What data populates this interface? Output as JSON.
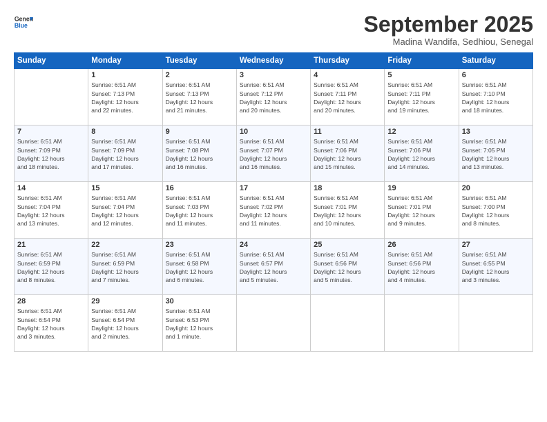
{
  "header": {
    "logo_line1": "General",
    "logo_line2": "Blue",
    "month_title": "September 2025",
    "subtitle": "Madina Wandifa, Sedhiou, Senegal"
  },
  "weekdays": [
    "Sunday",
    "Monday",
    "Tuesday",
    "Wednesday",
    "Thursday",
    "Friday",
    "Saturday"
  ],
  "weeks": [
    [
      {
        "day": "",
        "info": ""
      },
      {
        "day": "1",
        "info": "Sunrise: 6:51 AM\nSunset: 7:13 PM\nDaylight: 12 hours\nand 22 minutes."
      },
      {
        "day": "2",
        "info": "Sunrise: 6:51 AM\nSunset: 7:13 PM\nDaylight: 12 hours\nand 21 minutes."
      },
      {
        "day": "3",
        "info": "Sunrise: 6:51 AM\nSunset: 7:12 PM\nDaylight: 12 hours\nand 20 minutes."
      },
      {
        "day": "4",
        "info": "Sunrise: 6:51 AM\nSunset: 7:11 PM\nDaylight: 12 hours\nand 20 minutes."
      },
      {
        "day": "5",
        "info": "Sunrise: 6:51 AM\nSunset: 7:11 PM\nDaylight: 12 hours\nand 19 minutes."
      },
      {
        "day": "6",
        "info": "Sunrise: 6:51 AM\nSunset: 7:10 PM\nDaylight: 12 hours\nand 18 minutes."
      }
    ],
    [
      {
        "day": "7",
        "info": "Sunrise: 6:51 AM\nSunset: 7:09 PM\nDaylight: 12 hours\nand 18 minutes."
      },
      {
        "day": "8",
        "info": "Sunrise: 6:51 AM\nSunset: 7:09 PM\nDaylight: 12 hours\nand 17 minutes."
      },
      {
        "day": "9",
        "info": "Sunrise: 6:51 AM\nSunset: 7:08 PM\nDaylight: 12 hours\nand 16 minutes."
      },
      {
        "day": "10",
        "info": "Sunrise: 6:51 AM\nSunset: 7:07 PM\nDaylight: 12 hours\nand 16 minutes."
      },
      {
        "day": "11",
        "info": "Sunrise: 6:51 AM\nSunset: 7:06 PM\nDaylight: 12 hours\nand 15 minutes."
      },
      {
        "day": "12",
        "info": "Sunrise: 6:51 AM\nSunset: 7:06 PM\nDaylight: 12 hours\nand 14 minutes."
      },
      {
        "day": "13",
        "info": "Sunrise: 6:51 AM\nSunset: 7:05 PM\nDaylight: 12 hours\nand 13 minutes."
      }
    ],
    [
      {
        "day": "14",
        "info": "Sunrise: 6:51 AM\nSunset: 7:04 PM\nDaylight: 12 hours\nand 13 minutes."
      },
      {
        "day": "15",
        "info": "Sunrise: 6:51 AM\nSunset: 7:04 PM\nDaylight: 12 hours\nand 12 minutes."
      },
      {
        "day": "16",
        "info": "Sunrise: 6:51 AM\nSunset: 7:03 PM\nDaylight: 12 hours\nand 11 minutes."
      },
      {
        "day": "17",
        "info": "Sunrise: 6:51 AM\nSunset: 7:02 PM\nDaylight: 12 hours\nand 11 minutes."
      },
      {
        "day": "18",
        "info": "Sunrise: 6:51 AM\nSunset: 7:01 PM\nDaylight: 12 hours\nand 10 minutes."
      },
      {
        "day": "19",
        "info": "Sunrise: 6:51 AM\nSunset: 7:01 PM\nDaylight: 12 hours\nand 9 minutes."
      },
      {
        "day": "20",
        "info": "Sunrise: 6:51 AM\nSunset: 7:00 PM\nDaylight: 12 hours\nand 8 minutes."
      }
    ],
    [
      {
        "day": "21",
        "info": "Sunrise: 6:51 AM\nSunset: 6:59 PM\nDaylight: 12 hours\nand 8 minutes."
      },
      {
        "day": "22",
        "info": "Sunrise: 6:51 AM\nSunset: 6:59 PM\nDaylight: 12 hours\nand 7 minutes."
      },
      {
        "day": "23",
        "info": "Sunrise: 6:51 AM\nSunset: 6:58 PM\nDaylight: 12 hours\nand 6 minutes."
      },
      {
        "day": "24",
        "info": "Sunrise: 6:51 AM\nSunset: 6:57 PM\nDaylight: 12 hours\nand 5 minutes."
      },
      {
        "day": "25",
        "info": "Sunrise: 6:51 AM\nSunset: 6:56 PM\nDaylight: 12 hours\nand 5 minutes."
      },
      {
        "day": "26",
        "info": "Sunrise: 6:51 AM\nSunset: 6:56 PM\nDaylight: 12 hours\nand 4 minutes."
      },
      {
        "day": "27",
        "info": "Sunrise: 6:51 AM\nSunset: 6:55 PM\nDaylight: 12 hours\nand 3 minutes."
      }
    ],
    [
      {
        "day": "28",
        "info": "Sunrise: 6:51 AM\nSunset: 6:54 PM\nDaylight: 12 hours\nand 3 minutes."
      },
      {
        "day": "29",
        "info": "Sunrise: 6:51 AM\nSunset: 6:54 PM\nDaylight: 12 hours\nand 2 minutes."
      },
      {
        "day": "30",
        "info": "Sunrise: 6:51 AM\nSunset: 6:53 PM\nDaylight: 12 hours\nand 1 minute."
      },
      {
        "day": "",
        "info": ""
      },
      {
        "day": "",
        "info": ""
      },
      {
        "day": "",
        "info": ""
      },
      {
        "day": "",
        "info": ""
      }
    ]
  ]
}
